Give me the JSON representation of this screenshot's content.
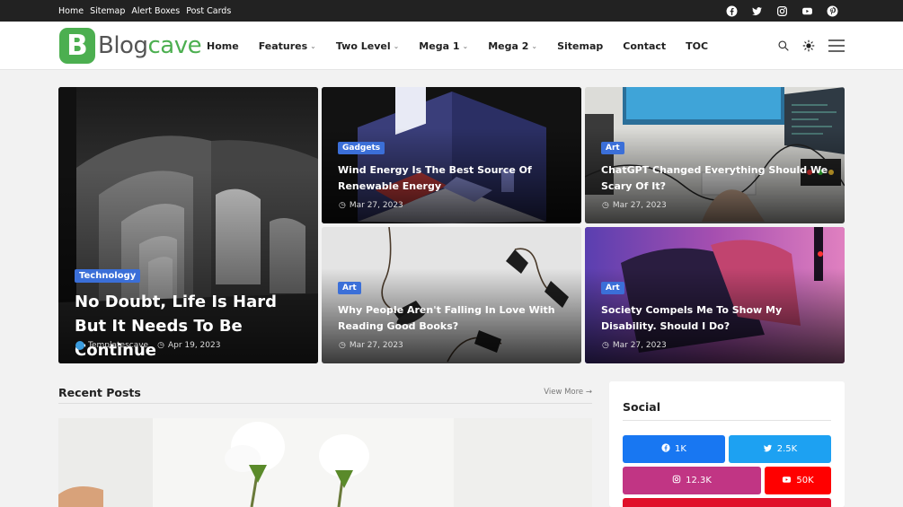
{
  "topbar": {
    "links": [
      "Home",
      "Sitemap",
      "Alert Boxes",
      "Post Cards"
    ],
    "social": [
      "facebook-icon",
      "twitter-icon",
      "instagram-icon",
      "youtube-icon",
      "pinterest-icon"
    ]
  },
  "header": {
    "logo_letter": "B",
    "logo_text_1": "Blog",
    "logo_text_2": "cave",
    "nav": [
      {
        "label": "Home",
        "dropdown": false
      },
      {
        "label": "Features",
        "dropdown": true
      },
      {
        "label": "Two Level",
        "dropdown": true
      },
      {
        "label": "Mega 1",
        "dropdown": true
      },
      {
        "label": "Mega 2",
        "dropdown": true
      },
      {
        "label": "Sitemap",
        "dropdown": false
      },
      {
        "label": "Contact",
        "dropdown": false
      },
      {
        "label": "TOC",
        "dropdown": false
      }
    ]
  },
  "featured": [
    {
      "category": "Technology",
      "title": "No Doubt, Life Is Hard But It Needs To Be Continue",
      "author": "Templatescave",
      "date": "Apr 19, 2023"
    },
    {
      "category": "Gadgets",
      "title": "Wind Energy Is The Best Source Of Renewable Energy",
      "date": "Mar 27, 2023"
    },
    {
      "category": "Art",
      "title": "ChatGPT Changed Everything Should We Scary Of It?",
      "date": "Mar 27, 2023"
    },
    {
      "category": "Art",
      "title": "Why People Aren't Falling In Love With Reading Good Books?",
      "date": "Mar 27, 2023"
    },
    {
      "category": "Art",
      "title": "Society Compels Me To Show My Disability. Should I Do?",
      "date": "Mar 27, 2023"
    }
  ],
  "recent": {
    "title": "Recent Posts",
    "view_more": "View More"
  },
  "sidebar": {
    "title": "Social",
    "buttons": [
      {
        "network": "facebook",
        "count": "1K",
        "color": "#1877f2"
      },
      {
        "network": "twitter",
        "count": "2.5K",
        "color": "#1da1f2"
      },
      {
        "network": "instagram",
        "count": "12.3K",
        "color": "#c13584"
      },
      {
        "network": "youtube",
        "count": "50K",
        "color": "#ff0000"
      }
    ]
  },
  "colors": {
    "accent": "#4caf50",
    "category_badge": "#3b6fd8",
    "topbar": "#222222"
  }
}
